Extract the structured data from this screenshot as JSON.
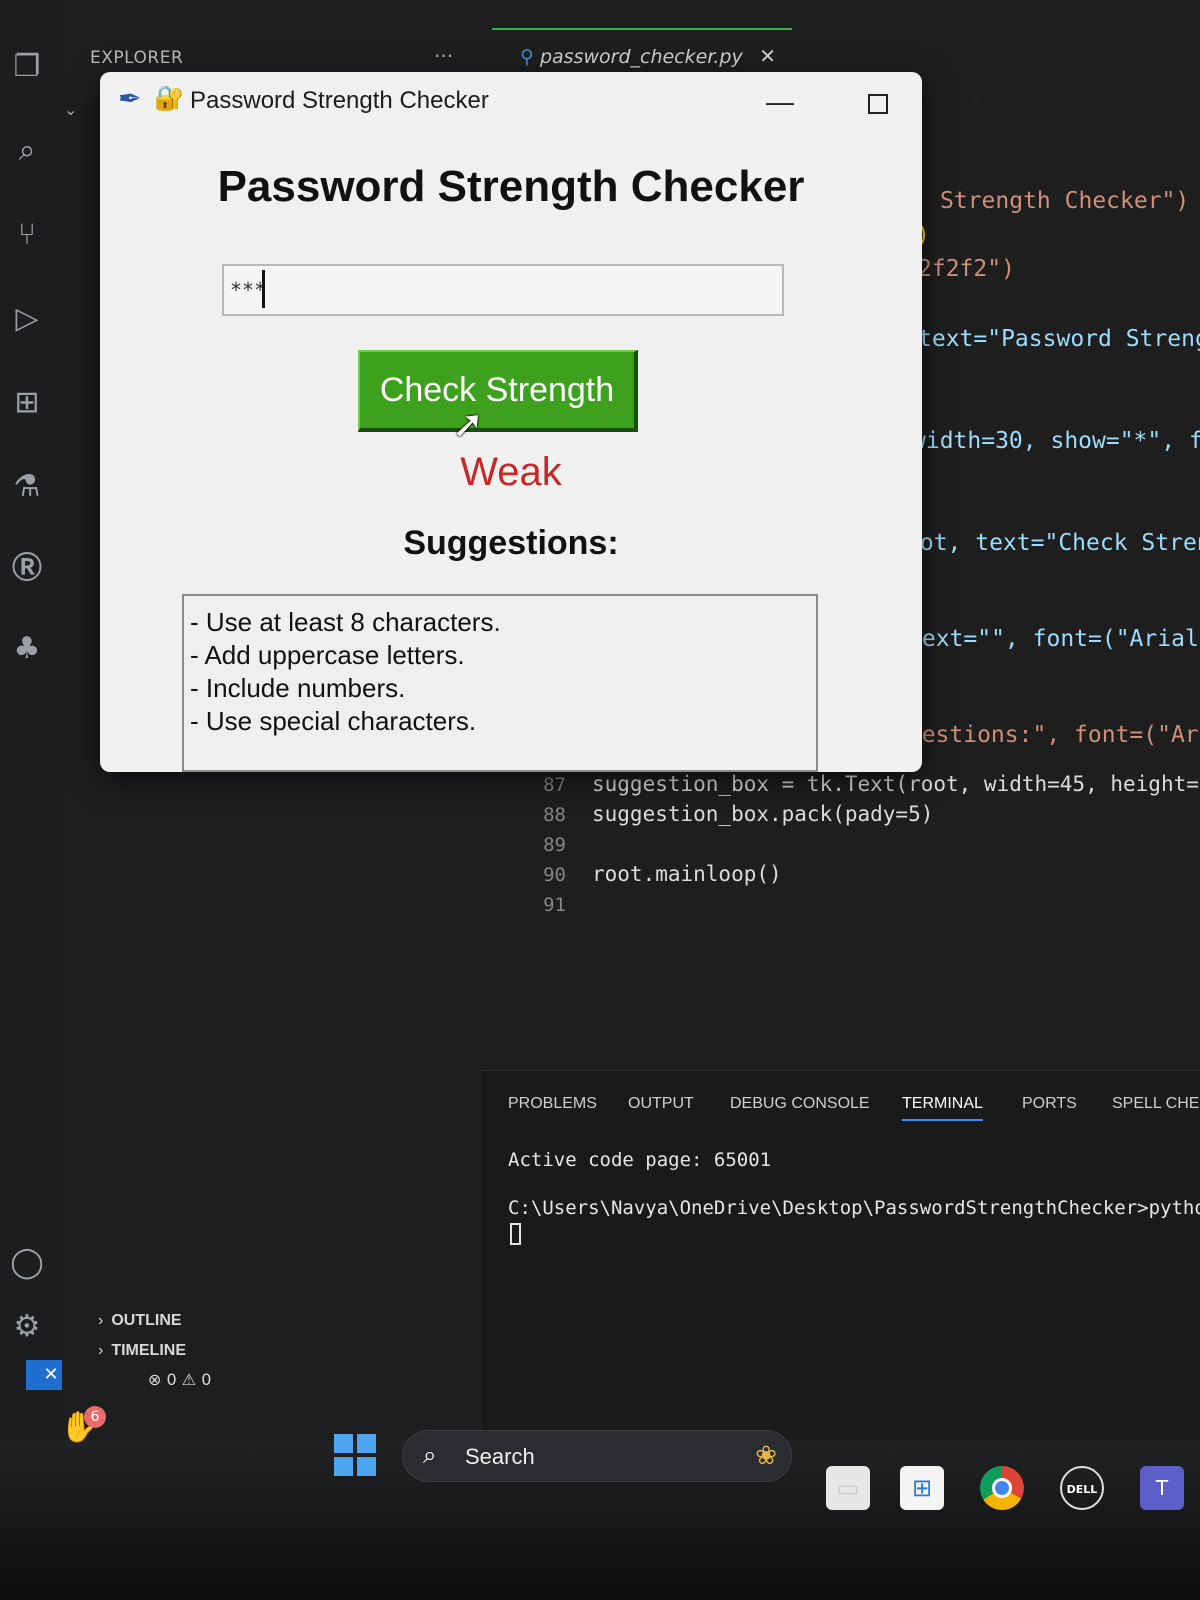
{
  "activity_bar": {
    "icons": [
      "files-icon",
      "search-icon",
      "source-control-icon",
      "run-debug-icon",
      "extensions-icon",
      "testing-icon",
      "r-icon",
      "tree-icon",
      "accounts-icon",
      "settings-icon"
    ]
  },
  "sidebar": {
    "title": "EXPLORER",
    "more": "···",
    "sections": [
      {
        "label": "OUTLINE"
      },
      {
        "label": "TIMELINE"
      }
    ]
  },
  "status": {
    "errors": "0",
    "warnings": "0"
  },
  "editor": {
    "tab_label": "password_checker.py",
    "partial_code": [
      "Strength Checker\")",
      ")",
      "2f2f2\")",
      "text=\"Password Streng",
      "width=30, show=\"*\", fo",
      "pot, text=\"Check Streng",
      "text=\"\", font=(\"Arial\"",
      "ggestions:\", font=(\"Aria"
    ],
    "lines": [
      {
        "number": "87",
        "code": "suggestion_box = tk.Text(root, width=45, height="
      },
      {
        "number": "88",
        "code": "suggestion_box.pack(pady=5)"
      },
      {
        "number": "89",
        "code": ""
      },
      {
        "number": "90",
        "code": "root.mainloop()"
      },
      {
        "number": "91",
        "code": ""
      }
    ]
  },
  "panel": {
    "tabs": [
      "PROBLEMS",
      "OUTPUT",
      "DEBUG CONSOLE",
      "TERMINAL",
      "PORTS",
      "SPELL CHE"
    ],
    "active_tab": "TERMINAL",
    "terminal_lines": [
      "Active code page: 65001",
      "C:\\Users\\Navya\\OneDrive\\Desktop\\PasswordStrengthChecker>pytho"
    ]
  },
  "app_window": {
    "title": "Password Strength Checker",
    "heading": "Password Strength Checker",
    "password_value": "***",
    "button_label": "Check Strength",
    "result": "Weak",
    "result_color": "#c62828",
    "button_color": "#3da11e",
    "suggestions_heading": "Suggestions:",
    "suggestions": [
      "- Use at least 8 characters.",
      "- Add uppercase letters.",
      "- Include numbers.",
      "- Use special characters."
    ]
  },
  "taskbar": {
    "notification_count": "6",
    "search_label": "Search",
    "apps": [
      "file-explorer-icon",
      "microsoft-store-icon",
      "chrome-icon",
      "dell-icon",
      "teams-icon"
    ]
  }
}
